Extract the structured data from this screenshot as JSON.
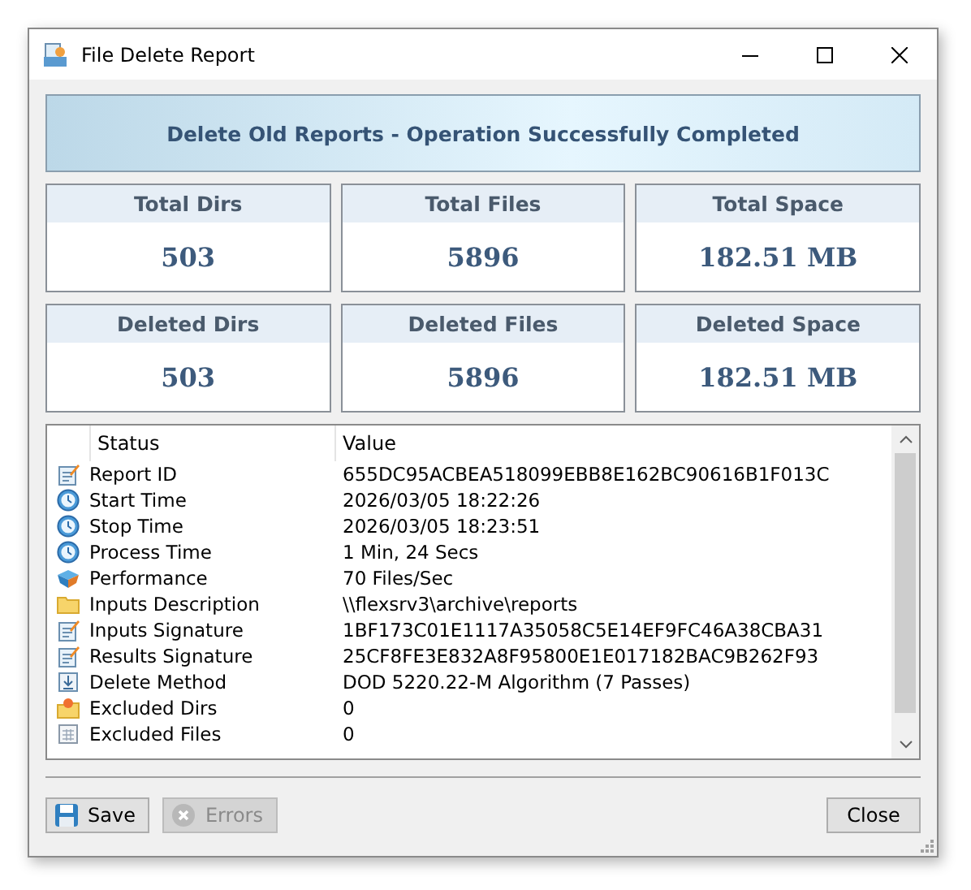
{
  "window": {
    "title": "File Delete Report"
  },
  "banner": {
    "text": "Delete Old Reports - Operation Successfully Completed"
  },
  "stats": [
    {
      "label": "Total Dirs",
      "value": "503"
    },
    {
      "label": "Total Files",
      "value": "5896"
    },
    {
      "label": "Total Space",
      "value": "182.51 MB"
    },
    {
      "label": "Deleted Dirs",
      "value": "503"
    },
    {
      "label": "Deleted Files",
      "value": "5896"
    },
    {
      "label": "Deleted Space",
      "value": "182.51 MB"
    }
  ],
  "table": {
    "columns": [
      "Status",
      "Value"
    ],
    "rows": [
      {
        "kind": "note",
        "status": "Report ID",
        "value": "655DC95ACBEA518099EBB8E162BC90616B1F013C"
      },
      {
        "kind": "clock",
        "status": "Start Time",
        "value": "2026/03/05 18:22:26"
      },
      {
        "kind": "clock",
        "status": "Stop Time",
        "value": "2026/03/05 18:23:51"
      },
      {
        "kind": "clock",
        "status": "Process Time",
        "value": "1 Min, 24 Secs"
      },
      {
        "kind": "speed",
        "status": "Performance",
        "value": "70 Files/Sec"
      },
      {
        "kind": "folder",
        "status": "Inputs Description",
        "value": "\\\\flexsrv3\\archive\\reports"
      },
      {
        "kind": "note",
        "status": "Inputs Signature",
        "value": "1BF173C01E1117A35058C5E14EF9FC46A38CBA31"
      },
      {
        "kind": "note",
        "status": "Results Signature",
        "value": "25CF8FE3E832A8F95800E1E017182BAC9B262F93"
      },
      {
        "kind": "method",
        "status": "Delete Method",
        "value": "DOD 5220.22-M Algorithm (7 Passes)"
      },
      {
        "kind": "dirs",
        "status": "Excluded Dirs",
        "value": "0"
      },
      {
        "kind": "files",
        "status": "Excluded Files",
        "value": "0"
      }
    ]
  },
  "buttons": [
    {
      "kind": "save",
      "label": "Save",
      "disabled": false
    },
    {
      "kind": "errors",
      "label": "Errors",
      "disabled": true
    },
    {
      "kind": "close",
      "label": "Close",
      "disabled": false
    }
  ]
}
